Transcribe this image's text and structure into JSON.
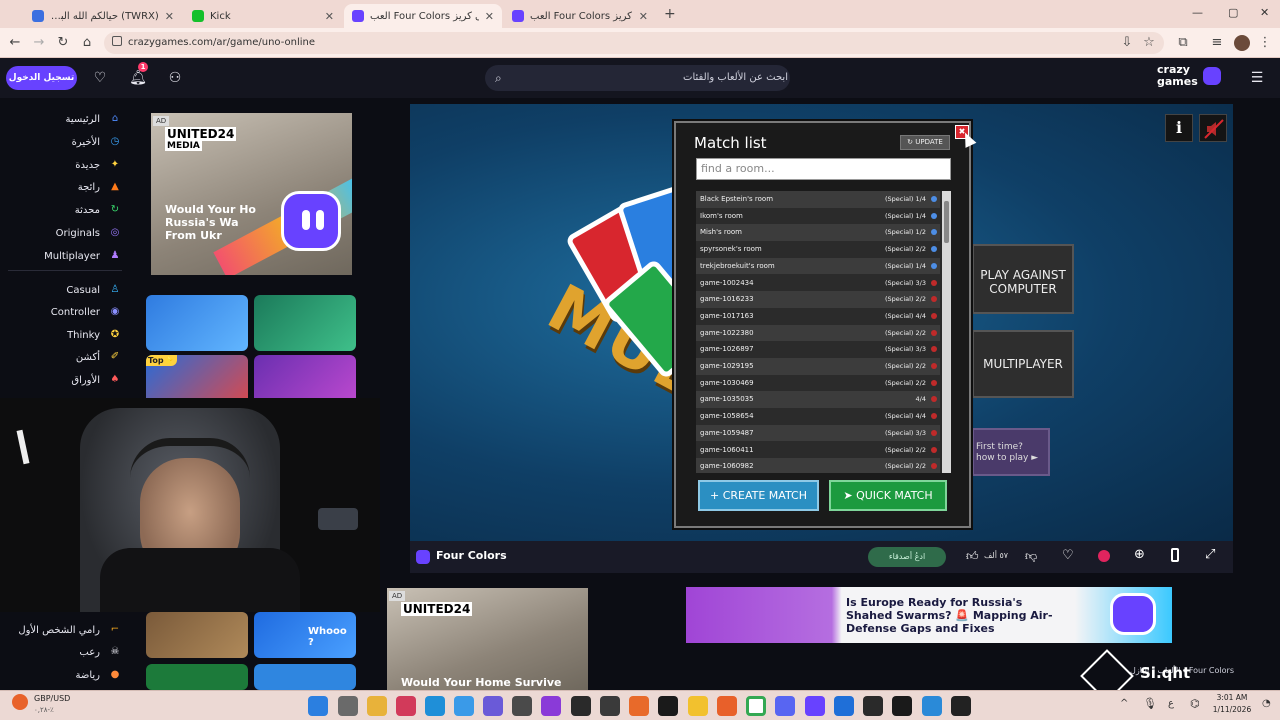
{
  "browser": {
    "tabs": [
      {
        "title": "(TWRX) حيالكم الله البث هنا وحاكو",
        "color": "#3b6fe0"
      },
      {
        "title": "Kick",
        "color": "#15c02b"
      },
      {
        "title": "العب Four Colors على كريز",
        "color": "#6842ff"
      },
      {
        "title": "العب Four Colors على كريز",
        "color": "#6842ff"
      }
    ],
    "url": "crazygames.com/ar/game/uno-online",
    "new_tab": "+",
    "window_controls": {
      "minimize": "—",
      "maximize": "▢",
      "close": "✕"
    }
  },
  "header": {
    "login": "تسجيل الدخول",
    "notification_count": "1",
    "search_placeholder": "ابحث عن الألعاب والفئات",
    "logo_top": "crazy",
    "logo_bottom": "games"
  },
  "sidebar": {
    "items": [
      {
        "label": "الرئيسية",
        "icon": "home-icon",
        "color": "#4f8cff",
        "glyph": "⌂"
      },
      {
        "label": "الأخيرة",
        "icon": "recent-icon",
        "color": "#3ba7ff",
        "glyph": "◷"
      },
      {
        "label": "جديدة",
        "icon": "sparkle-icon",
        "color": "#ffd23f",
        "glyph": "✦"
      },
      {
        "label": "رائجة",
        "icon": "fire-icon",
        "color": "#ff7a1a",
        "glyph": "▲"
      },
      {
        "label": "محدثة",
        "icon": "update-icon",
        "color": "#38d66b",
        "glyph": "↻"
      },
      {
        "label": "Originals",
        "icon": "originals-icon",
        "color": "#9c7bff",
        "glyph": "◎"
      },
      {
        "label": "Multiplayer",
        "icon": "multiplayer-icon",
        "color": "#b07cff",
        "glyph": "♟"
      },
      {
        "label": "Casual",
        "icon": "casual-icon",
        "color": "#38b6ff",
        "glyph": "♙"
      },
      {
        "label": "Controller",
        "icon": "controller-icon",
        "color": "#8a8fff",
        "glyph": "◉"
      },
      {
        "label": "Thinky",
        "icon": "thinky-icon",
        "color": "#ffd23f",
        "glyph": "✪"
      },
      {
        "label": "أكشن",
        "icon": "action-icon",
        "color": "#ffd23f",
        "glyph": "✐"
      },
      {
        "label": "الأوراق",
        "icon": "cards-icon",
        "color": "#ff5a5a",
        "glyph": "♠"
      }
    ],
    "bottom_items": [
      {
        "label": "رامي الشخص الأول",
        "icon": "shooter-icon",
        "color": "#ffb020",
        "glyph": "⌐"
      },
      {
        "label": "رعب",
        "icon": "horror-icon",
        "color": "#e8e8f0",
        "glyph": "☠"
      },
      {
        "label": "رياضة",
        "icon": "sports-icon",
        "color": "#ff8a3a",
        "glyph": "●"
      }
    ]
  },
  "ads": {
    "ad_label": "AD",
    "brand": "UNITED24",
    "brand_sub": "MEDIA",
    "ad1_text": "Would Your Ho\nRussia's Wa\nFrom Ukr",
    "ad2_text": "Would Your Home Survive",
    "banner_text": "Is Europe Ready for Russia's Shahed Swarms? 🚨 Mapping Air-Defense Gaps and Fixes",
    "top_badge": "Top⭐",
    "thumb_whooo": "Whooo ?"
  },
  "game": {
    "bg_word": "MULTI",
    "side_buttons": {
      "play_computer": "PLAY AGAINST COMPUTER",
      "multiplayer": "MULTIPLAYER",
      "first_time": "First time?\nhow to play ►"
    },
    "match_list": {
      "title": "Match list",
      "update": "UPDATE",
      "search_placeholder": "find a room...",
      "rows": [
        {
          "name": "Black Epstein's room",
          "mode": "(Special) 1/4",
          "locked": true
        },
        {
          "name": "Ikom's room",
          "mode": "(Special) 1/4",
          "locked": true
        },
        {
          "name": "Mish's room",
          "mode": "(Special) 1/2",
          "locked": true
        },
        {
          "name": "spyrsonek's room",
          "mode": "(Special) 2/2",
          "locked": true
        },
        {
          "name": "trekjebroekuit's room",
          "mode": "(Special) 1/4",
          "locked": true
        },
        {
          "name": "game-1002434",
          "mode": "(Special) 3/3",
          "locked": false
        },
        {
          "name": "game-1016233",
          "mode": "(Special) 2/2",
          "locked": false
        },
        {
          "name": "game-1017163",
          "mode": "(Special) 4/4",
          "locked": false
        },
        {
          "name": "game-1022380",
          "mode": "(Special) 2/2",
          "locked": false
        },
        {
          "name": "game-1026897",
          "mode": "(Special) 3/3",
          "locked": false
        },
        {
          "name": "game-1029195",
          "mode": "(Special) 2/2",
          "locked": false
        },
        {
          "name": "game-1030469",
          "mode": "(Special) 2/2",
          "locked": false
        },
        {
          "name": "game-1035035",
          "mode": "4/4",
          "locked": false
        },
        {
          "name": "game-1058654",
          "mode": "(Special) 4/4",
          "locked": false
        },
        {
          "name": "game-1059487",
          "mode": "(Special) 3/3",
          "locked": false
        },
        {
          "name": "game-1060411",
          "mode": "(Special) 2/2",
          "locked": false
        },
        {
          "name": "game-1060982",
          "mode": "(Special) 2/2",
          "locked": false
        }
      ],
      "create_match": "+ CREATE MATCH",
      "quick_match": "➤ QUICK MATCH",
      "close": "✖"
    },
    "info_icon": "i",
    "sound_icon": "🔇"
  },
  "game_bar": {
    "title": "Four Colors",
    "invite": "ادعُ أصدقاء",
    "likes": "٥٧ ألف"
  },
  "footer": {
    "breadcrumb": "الألعاب › البازل › Four Colors",
    "watermark": "Si.qht"
  },
  "taskbar": {
    "currency": "GBP/USD",
    "change": "٠,٢٨-٪",
    "lang": "ع",
    "time": "3:01 AM",
    "date": "1/11/2026"
  },
  "colors": {
    "accent": "#6842ff",
    "create_btn": "#2b8fc2",
    "quick_btn": "#1c9a3f",
    "close_btn": "#d8262e"
  }
}
